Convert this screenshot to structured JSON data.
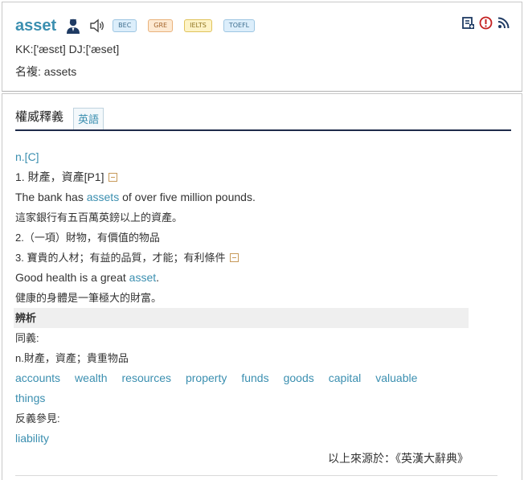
{
  "entry": {
    "word": "asset",
    "badges": [
      "BEC",
      "GRE",
      "IELTS",
      "TOEFL"
    ],
    "pronunciation": "KK:['æsɛt] DJ:['æset]",
    "plural": "名複: assets"
  },
  "tabs": {
    "main": "權威釋義",
    "english": "英語"
  },
  "content": {
    "pos": "n.[C]",
    "sense1": "1. 財產，資產[P1]",
    "ex1_before": "The bank has ",
    "ex1_link": "assets",
    "ex1_after": " of over five million pounds.",
    "ex1_cn": "這家銀行有五百萬英鎊以上的資產。",
    "sense2": "2.（一項）財物，有價值的物品",
    "sense3": "3. 寶貴的人材；有益的品質，才能；有利條件",
    "ex2_before": "Good health is a great ",
    "ex2_link": "asset",
    "ex2_after": ".",
    "ex2_cn": "健康的身體是一筆極大的財富。",
    "analysis_heading": "辨析",
    "synonyms_label": "同義:",
    "synonyms_def": "n.財產，資產；貴重物品",
    "synonyms": [
      "accounts",
      "wealth",
      "resources",
      "property",
      "funds",
      "goods",
      "capital",
      "valuable",
      "things"
    ],
    "antonyms_label": "反義參見:",
    "antonyms": [
      "liability"
    ],
    "source": "以上來源於：《英漢大辭典》"
  }
}
